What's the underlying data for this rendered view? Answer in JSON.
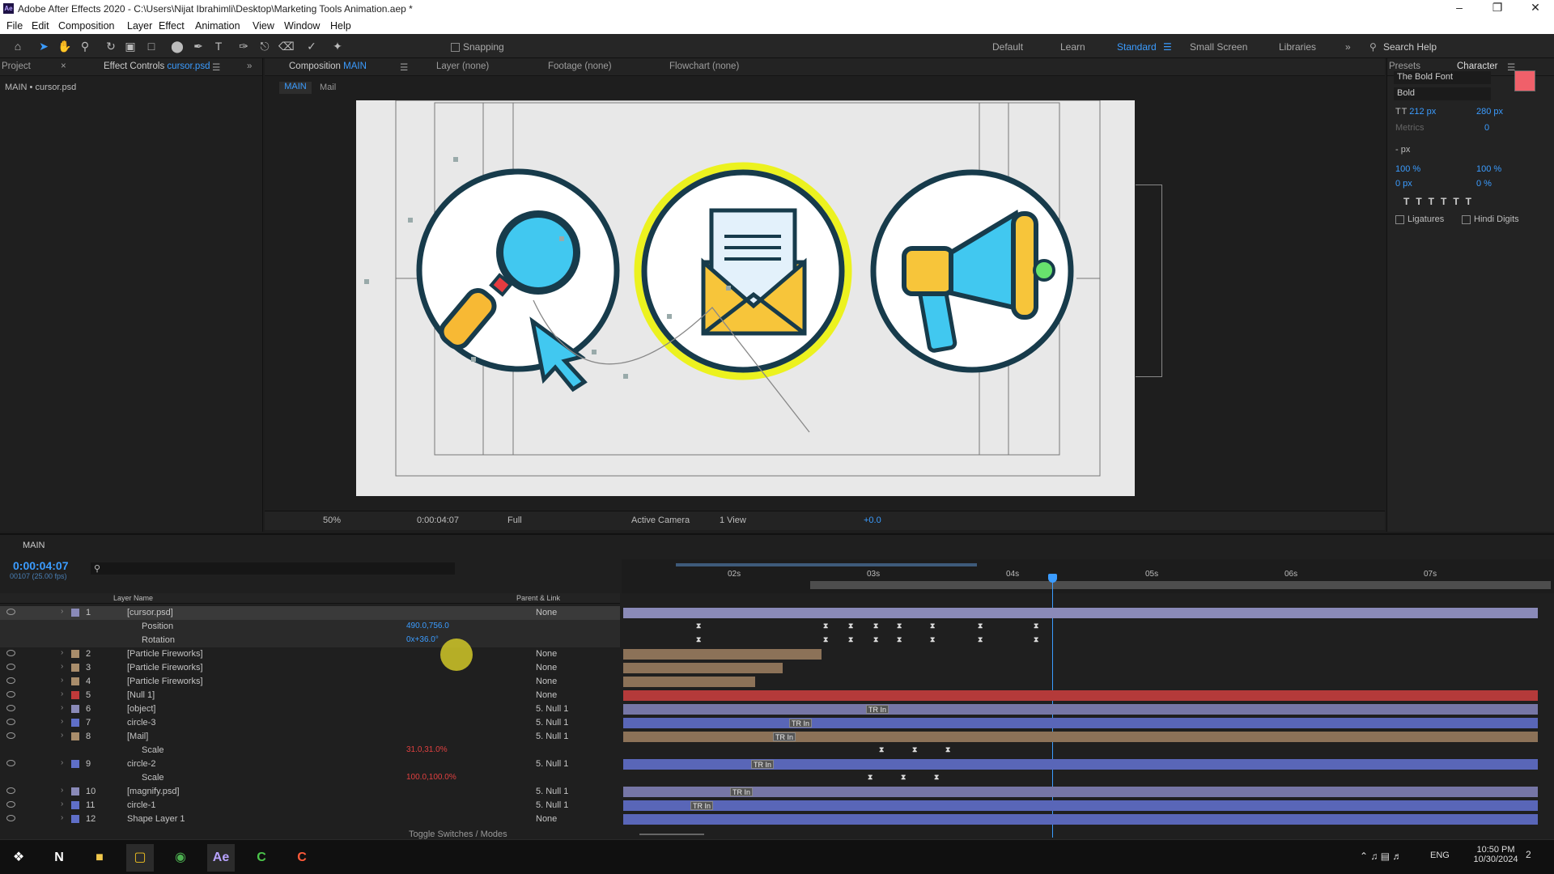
{
  "titlebar": {
    "title": "Adobe After Effects 2020 - C:\\Users\\Nijat Ibrahimli\\Desktop\\Marketing Tools Animation.aep *",
    "app_icon": "Ae"
  },
  "menu": [
    "File",
    "Edit",
    "Composition",
    "Layer",
    "Effect",
    "Animation",
    "View",
    "Window",
    "Help"
  ],
  "toolbar": {
    "snapping": "Snapping",
    "workspaces": [
      "Default",
      "Learn",
      "Standard",
      "Small Screen",
      "Libraries"
    ],
    "active_workspace": "Standard",
    "search_placeholder": "Search Help"
  },
  "left_panel": {
    "tab_project": "Project",
    "tab_effect_controls": "Effect Controls",
    "effect_layer": "cursor.psd",
    "breadcrumb": "MAIN • cursor.psd"
  },
  "comp_panel": {
    "tab_composition": "Composition",
    "comp_name": "MAIN",
    "tab_layer": "Layer (none)",
    "tab_footage": "Footage (none)",
    "tab_flowchart": "Flowchart (none)",
    "nav": [
      "MAIN",
      "Mail"
    ]
  },
  "viewer_footer": {
    "zoom": "50%",
    "timecode": "0:00:04:07",
    "resolution": "Full",
    "camera": "Active Camera",
    "views": "1 View",
    "exposure": "+0.0"
  },
  "character": {
    "tab_presets": "Presets",
    "tab_character": "Character",
    "font": "The Bold Font",
    "style": "Bold",
    "size": "212 px",
    "leading": "280 px",
    "kerning": "Metrics",
    "tracking": "0",
    "stroke": "- px",
    "vscale": "100 %",
    "hscale": "100 %",
    "baseline": "0 px",
    "tsume": "0 %",
    "ligatures": "Ligatures",
    "hindi": "Hindi Digits",
    "fill_color": "#f0606a"
  },
  "timeline": {
    "comp_tab": "MAIN",
    "timecode": "0:00:04:07",
    "frames": "00107 (25.00 fps)",
    "col_layer": "Layer Name",
    "col_parent": "Parent & Link",
    "ruler": [
      "02s",
      "03s",
      "04s",
      "05s",
      "06s",
      "07s"
    ],
    "rows": [
      {
        "num": "1",
        "name": "[cursor.psd]",
        "parent": "None",
        "label": "#8a8ab8"
      },
      {
        "num": "",
        "name": "Position",
        "value": "490.0,756.0"
      },
      {
        "num": "",
        "name": "Rotation",
        "value": "0x+36.0°"
      },
      {
        "num": "2",
        "name": "[Particle Fireworks]",
        "parent": "None",
        "label": "#a98d6b"
      },
      {
        "num": "3",
        "name": "[Particle Fireworks]",
        "parent": "None",
        "label": "#a98d6b"
      },
      {
        "num": "4",
        "name": "[Particle Fireworks]",
        "parent": "None",
        "label": "#a98d6b"
      },
      {
        "num": "5",
        "name": "[Null 1]",
        "parent": "None",
        "label": "#c03a3a"
      },
      {
        "num": "6",
        "name": "[object]",
        "parent": "5. Null 1",
        "label": "#8a8ab8"
      },
      {
        "num": "7",
        "name": "circle-3",
        "parent": "5. Null 1",
        "label": "#5f6fc8"
      },
      {
        "num": "8",
        "name": "[Mail]",
        "parent": "5. Null 1",
        "label": "#a98d6b"
      },
      {
        "num": "",
        "name": "Scale",
        "value": "31.0,31.0%"
      },
      {
        "num": "9",
        "name": "circle-2",
        "parent": "5. Null 1",
        "label": "#5f6fc8"
      },
      {
        "num": "",
        "name": "Scale",
        "value": "100.0,100.0%"
      },
      {
        "num": "10",
        "name": "[magnify.psd]",
        "parent": "5. Null 1",
        "label": "#8a8ab8"
      },
      {
        "num": "11",
        "name": "circle-1",
        "parent": "5. Null 1",
        "label": "#5f6fc8"
      },
      {
        "num": "12",
        "name": "Shape Layer 1",
        "parent": "None",
        "label": "#5f6fc8"
      }
    ],
    "tr_label": "TR In",
    "toggle": "Toggle Switches / Modes"
  },
  "taskbar": {
    "time": "10:50 PM",
    "date": "10/30/2024",
    "lang": "ENG",
    "notif": "2"
  }
}
